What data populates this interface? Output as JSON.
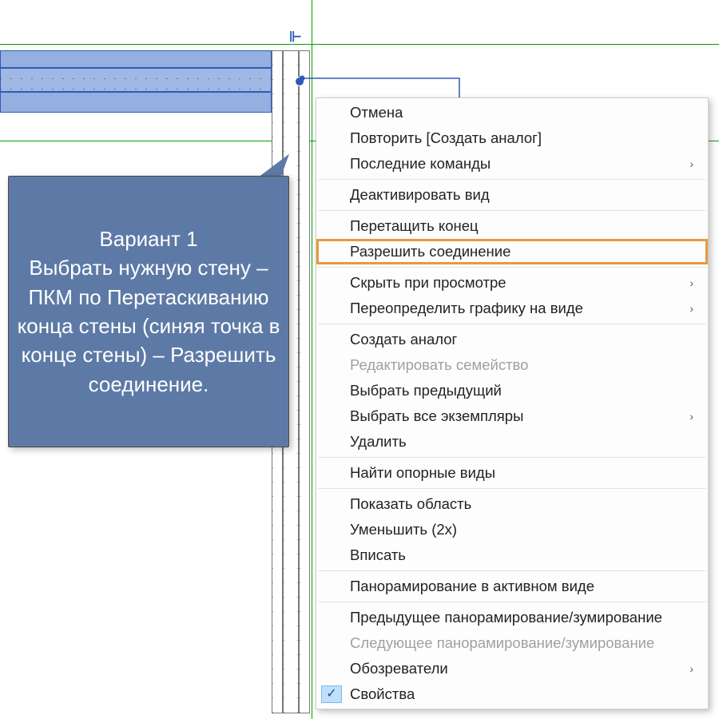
{
  "callout": {
    "text": "Вариант 1\nВыбрать нужную стену – ПКМ по Перетаскиванию конца стены (синяя точка в конце стены) – Разрешить соединение."
  },
  "context_menu": {
    "groups": [
      [
        {
          "label": "Отмена",
          "submenu": false,
          "disabled": false,
          "highlight": false,
          "checked": false
        },
        {
          "label": "Повторить [Создать аналог]",
          "submenu": false,
          "disabled": false,
          "highlight": false,
          "checked": false
        },
        {
          "label": "Последние команды",
          "submenu": true,
          "disabled": false,
          "highlight": false,
          "checked": false
        }
      ],
      [
        {
          "label": "Деактивировать вид",
          "submenu": false,
          "disabled": false,
          "highlight": false,
          "checked": false
        }
      ],
      [
        {
          "label": "Перетащить конец",
          "submenu": false,
          "disabled": false,
          "highlight": false,
          "checked": false
        },
        {
          "label": "Разрешить соединение",
          "submenu": false,
          "disabled": false,
          "highlight": true,
          "checked": false
        }
      ],
      [
        {
          "label": "Скрыть при просмотре",
          "submenu": true,
          "disabled": false,
          "highlight": false,
          "checked": false
        },
        {
          "label": "Переопределить графику на виде",
          "submenu": true,
          "disabled": false,
          "highlight": false,
          "checked": false
        }
      ],
      [
        {
          "label": "Создать аналог",
          "submenu": false,
          "disabled": false,
          "highlight": false,
          "checked": false
        },
        {
          "label": "Редактировать семейство",
          "submenu": false,
          "disabled": true,
          "highlight": false,
          "checked": false
        },
        {
          "label": "Выбрать предыдущий",
          "submenu": false,
          "disabled": false,
          "highlight": false,
          "checked": false
        },
        {
          "label": "Выбрать все экземпляры",
          "submenu": true,
          "disabled": false,
          "highlight": false,
          "checked": false
        },
        {
          "label": "Удалить",
          "submenu": false,
          "disabled": false,
          "highlight": false,
          "checked": false
        }
      ],
      [
        {
          "label": "Найти опорные виды",
          "submenu": false,
          "disabled": false,
          "highlight": false,
          "checked": false
        }
      ],
      [
        {
          "label": "Показать область",
          "submenu": false,
          "disabled": false,
          "highlight": false,
          "checked": false
        },
        {
          "label": "Уменьшить (2x)",
          "submenu": false,
          "disabled": false,
          "highlight": false,
          "checked": false
        },
        {
          "label": "Вписать",
          "submenu": false,
          "disabled": false,
          "highlight": false,
          "checked": false
        }
      ],
      [
        {
          "label": "Панорамирование в активном виде",
          "submenu": false,
          "disabled": false,
          "highlight": false,
          "checked": false
        }
      ],
      [
        {
          "label": "Предыдущее панорамирование/зумирование",
          "submenu": false,
          "disabled": false,
          "highlight": false,
          "checked": false
        },
        {
          "label": "Следующее панорамирование/зумирование",
          "submenu": false,
          "disabled": true,
          "highlight": false,
          "checked": false
        },
        {
          "label": "Обозреватели",
          "submenu": true,
          "disabled": false,
          "highlight": false,
          "checked": false
        },
        {
          "label": "Свойства",
          "submenu": false,
          "disabled": false,
          "highlight": false,
          "checked": true
        }
      ]
    ]
  }
}
